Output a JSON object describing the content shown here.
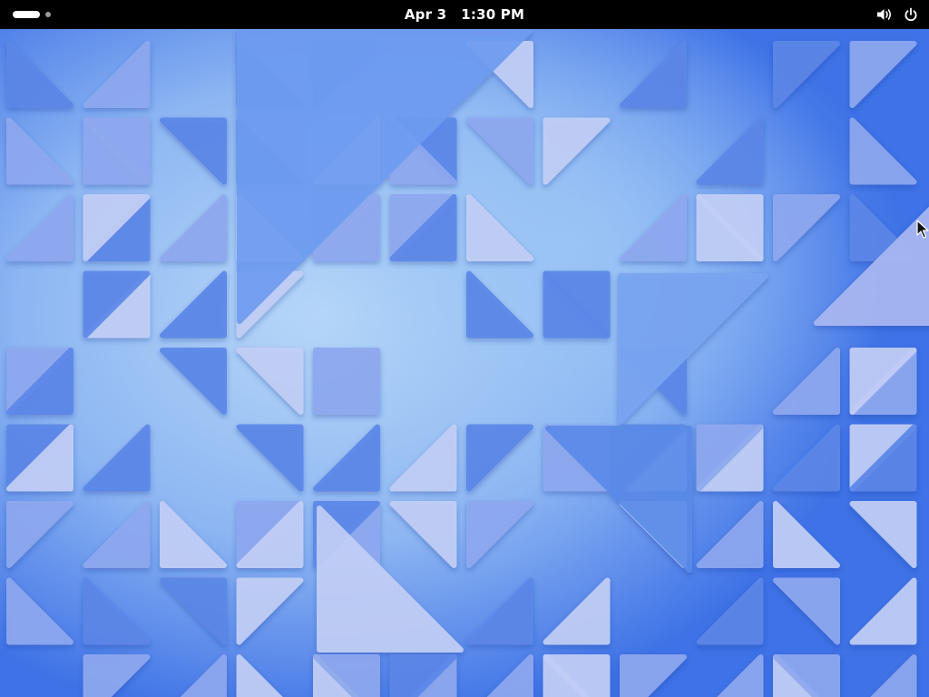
{
  "topbar": {
    "date": "Apr 3",
    "time": "1:30 PM",
    "workspaces": {
      "count": 2,
      "active": 1
    },
    "status_icons": [
      "volume-icon",
      "power-icon"
    ]
  },
  "wallpaper": {
    "theme": "blue triangle tiles",
    "colors": {
      "base": "#3f72e6",
      "light": "#a9c4f7",
      "glow": "#b8d8f8",
      "tile_light": "#c3cff6",
      "tile_mid": "#8fa9ef",
      "tile_dark": "#5c87e8"
    }
  }
}
